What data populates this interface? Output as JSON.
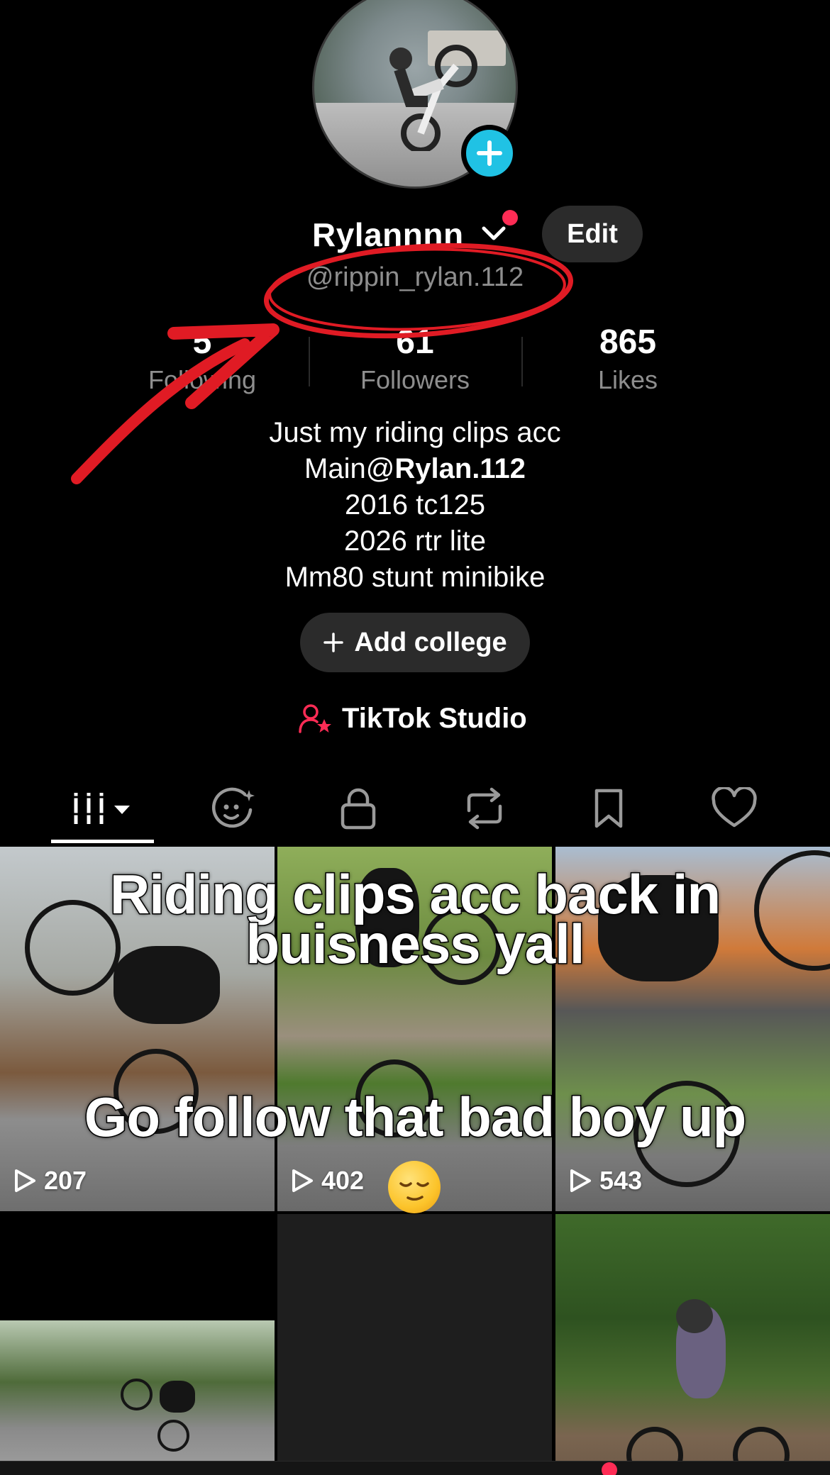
{
  "profile": {
    "display_name": "Rylannnn",
    "handle": "@rippin_rylan.112",
    "edit_label": "Edit"
  },
  "stats": {
    "following": {
      "value": "5",
      "label": "Following"
    },
    "followers": {
      "value": "61",
      "label": "Followers"
    },
    "likes": {
      "value": "865",
      "label": "Likes"
    }
  },
  "bio": {
    "line1": "Just my riding clips acc",
    "line2_prefix": "Main@",
    "line2_mention": "Rylan.112",
    "line3": "2016 tc125",
    "line4": "2026 rtr lite",
    "line5": "Mm80 stunt minibike"
  },
  "add_college_label": "Add college",
  "studio_label": "TikTok Studio",
  "tabs": [
    {
      "icon": "videos-grid-icon",
      "active": true
    },
    {
      "icon": "ai-face-icon"
    },
    {
      "icon": "lock-icon"
    },
    {
      "icon": "repost-icon"
    },
    {
      "icon": "bookmark-icon"
    },
    {
      "icon": "heart-icon"
    }
  ],
  "videos": [
    {
      "views": "207"
    },
    {
      "views": "402"
    },
    {
      "views": "543"
    }
  ],
  "caption_overlay": {
    "line1": "Riding clips acc back in",
    "line2": "buisness yall",
    "line3": "Go follow that bad boy up"
  },
  "colors": {
    "background": "#000000",
    "accent_red": "#fe2c55",
    "accent_cyan": "#20c2e4",
    "annotation_red": "#e01b24",
    "muted_text": "#8e8e8e"
  }
}
